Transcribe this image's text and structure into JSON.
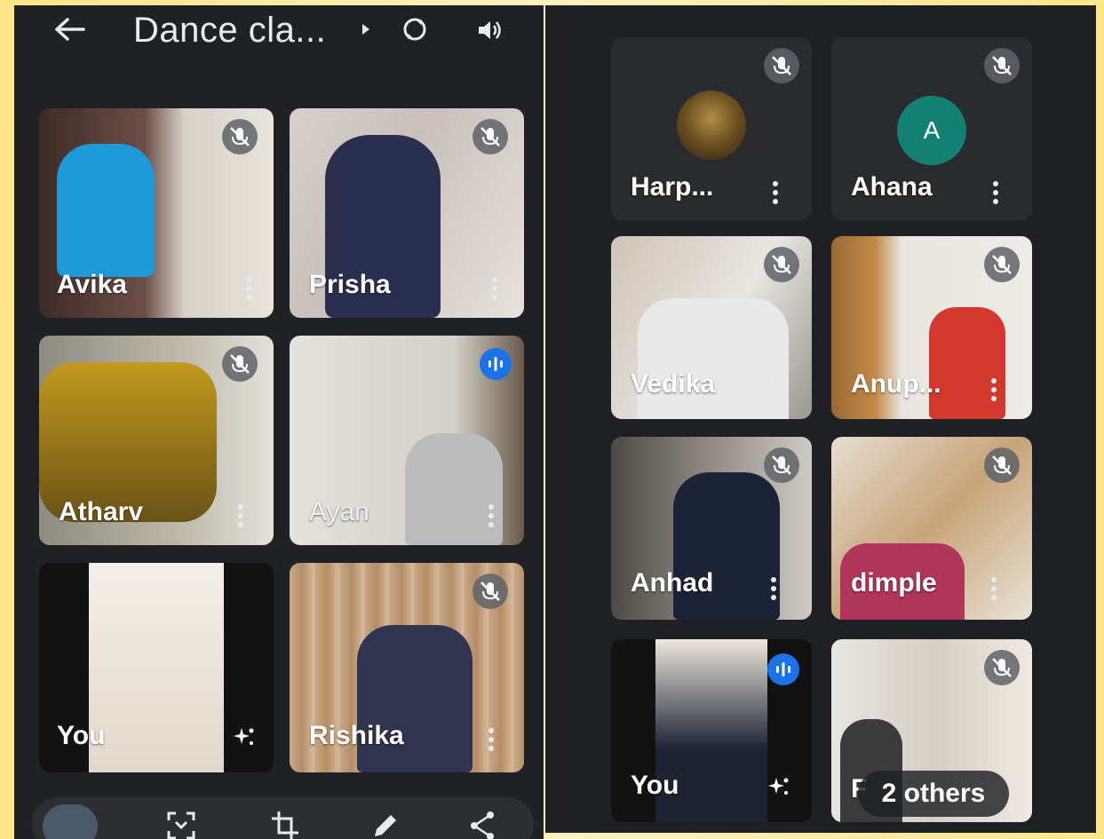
{
  "header": {
    "meeting_title": "Dance cla..."
  },
  "left_grid": {
    "tiles": [
      {
        "name": "Avika",
        "muted": true
      },
      {
        "name": "Prisha",
        "muted": true
      },
      {
        "name": "Atharv",
        "muted": true
      },
      {
        "name": "Ayan",
        "speaking": true
      },
      {
        "name": "You",
        "self": true
      },
      {
        "name": "Rishika",
        "muted": true
      }
    ]
  },
  "right_grid": {
    "tiles": [
      {
        "name": "Harp...",
        "muted": true,
        "avatar": "photo"
      },
      {
        "name": "Ahana",
        "muted": true,
        "avatar": "A"
      },
      {
        "name": "Vedika",
        "muted": true
      },
      {
        "name": "Anup...",
        "muted": true
      },
      {
        "name": "Anhad",
        "muted": true
      },
      {
        "name": "dimple",
        "muted": true
      },
      {
        "name": "You",
        "self": true,
        "speaking": true
      },
      {
        "name": "F",
        "muted": true
      }
    ],
    "others_chip": "2 others"
  },
  "icons": {
    "back": "arrow-left-icon",
    "dropdown": "triangle-right-icon",
    "switch_camera": "camera-switch-icon",
    "audio": "speaker-icon",
    "mic_off": "mic-off-icon",
    "speaking": "speaking-indicator-icon",
    "effects": "effects-icon",
    "more": "more-vert-icon",
    "bottom_toolbar": [
      "thumbnail-icon",
      "scan-icon",
      "crop-icon",
      "edit-icon",
      "share-icon"
    ]
  },
  "colors": {
    "background": "#202124",
    "speaking_blue": "#1a73e8",
    "avatar_teal": "#128073",
    "page_border": "#fde58a"
  }
}
